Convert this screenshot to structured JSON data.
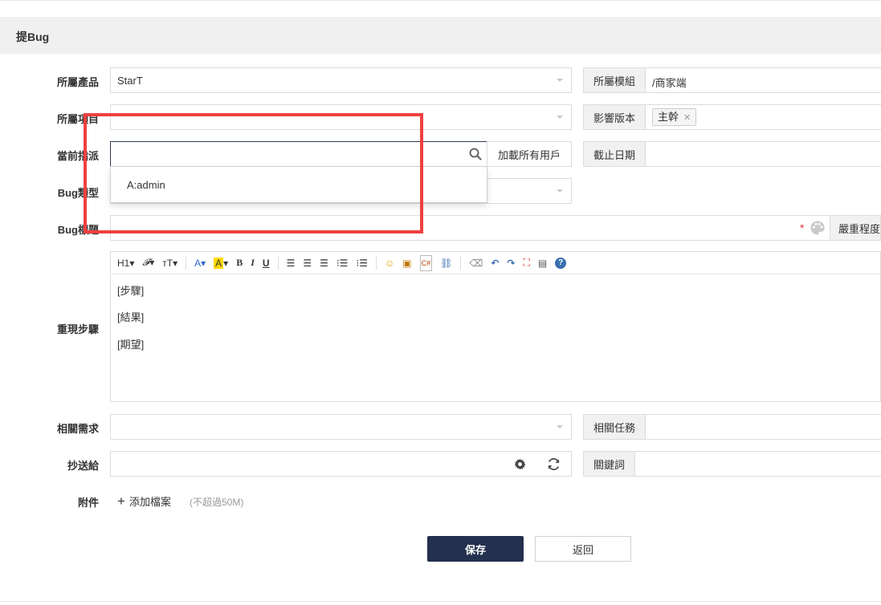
{
  "header": {
    "title": "提Bug"
  },
  "fields": {
    "product": {
      "label": "所屬產品",
      "value": "StarT"
    },
    "module": {
      "addon": "所屬模組",
      "value": "/商家端"
    },
    "project": {
      "label": "所屬項目",
      "value": ""
    },
    "build": {
      "addon": "影響版本",
      "tag": "主幹",
      "tag_remove": "✕"
    },
    "assigned": {
      "label": "當前指派",
      "value": "",
      "load_all_users": "加載所有用戶",
      "options": [
        "A:admin"
      ]
    },
    "deadline": {
      "addon": "截止日期",
      "value": ""
    },
    "type": {
      "label": "Bug類型",
      "value": ""
    },
    "title": {
      "label": "Bug標題",
      "required_mark": "*",
      "severity_addon": "嚴重程度"
    },
    "steps": {
      "label": "重現步驟",
      "lines": [
        "[步驟]",
        "[結果]",
        "[期望]"
      ]
    },
    "story": {
      "label": "相關需求",
      "value": ""
    },
    "task": {
      "addon": "相關任務",
      "value": ""
    },
    "mailto": {
      "label": "抄送給",
      "value": ""
    },
    "keywords": {
      "addon": "關鍵詞",
      "value": ""
    },
    "files": {
      "label": "附件",
      "add": "添加檔案",
      "limit": "(不超過50M)"
    }
  },
  "toolbar": [
    "H1",
    "𝓕",
    "тT",
    "A",
    "A",
    "B",
    "I",
    "U",
    "≡",
    "≡",
    "≡",
    "≔",
    "≔",
    "☺",
    "▣",
    "C#",
    "⛓",
    "⌫",
    "↶",
    "↷",
    "⛶",
    "📋",
    "?"
  ],
  "buttons": {
    "save": "保存",
    "back": "返回"
  },
  "colors": {
    "save_bg": "#23304e",
    "highlight": "#f04040",
    "required": "#e4393c"
  }
}
